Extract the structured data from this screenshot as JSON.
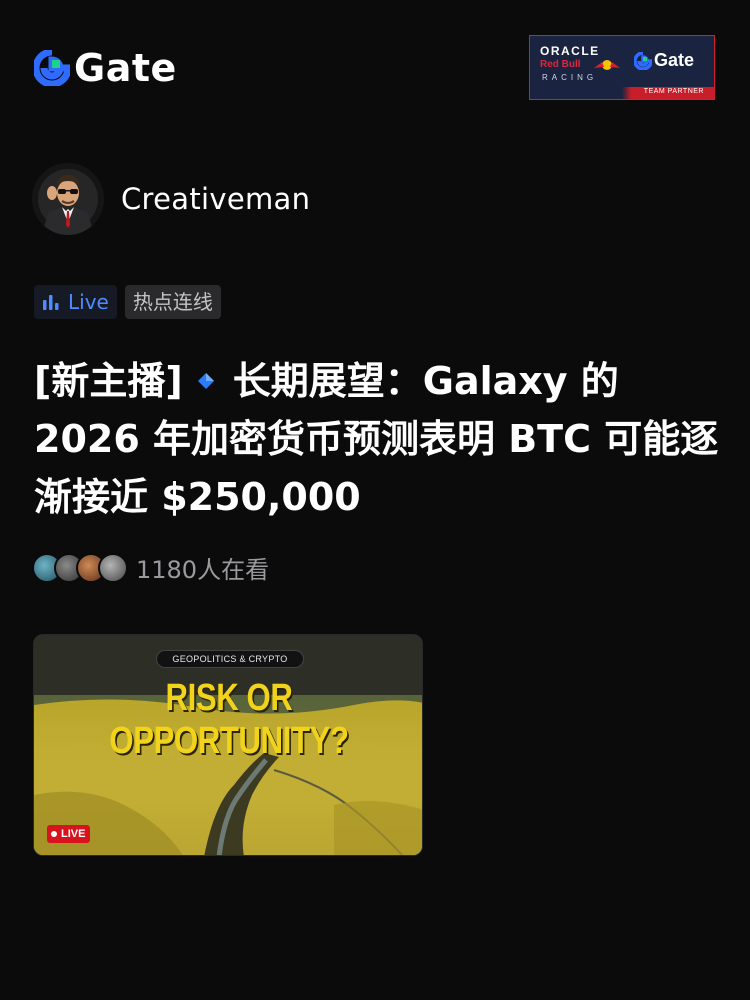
{
  "header": {
    "logo_text": "Gate",
    "partner": {
      "oracle": "ORACLE",
      "redbull": "Red Bull",
      "racing": "RACING",
      "gate": "Gate",
      "strip": "TEAM PARTNER"
    }
  },
  "author": {
    "name": "Creativeman"
  },
  "tags": [
    {
      "label": "Live",
      "icon": "bar-chart-icon"
    },
    {
      "label": "热点连线"
    }
  ],
  "post": {
    "title_prefix": "[新主播]",
    "title_main": "长期展望：Galaxy 的 2026 年加密货币预测表明 BTC 可能逐渐接近 $250,000"
  },
  "viewers": {
    "count_text": "1180人在看"
  },
  "video": {
    "topbar": "GEOPOLITICS & CRYPTO",
    "headline": "RISK OR OPPORTUNITY?",
    "live_label": "LIVE"
  },
  "colors": {
    "background": "#0b0b0c",
    "gate_blue": "#2f6bff",
    "gate_green": "#1fd18b",
    "live_blue": "#4d8bff",
    "headline_yellow": "#f2d31c",
    "live_red": "#d7141e"
  }
}
